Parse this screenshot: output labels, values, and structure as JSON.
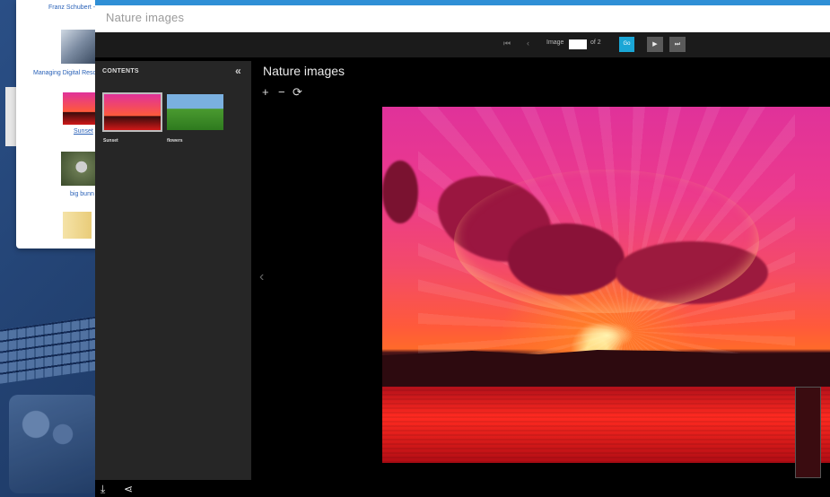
{
  "background": {
    "list": {
      "items": [
        {
          "caption": "Franz Schubert -"
        },
        {
          "caption": "Managing Digital Reso"
        },
        {
          "caption": "Sunset"
        },
        {
          "caption": "big bunn"
        },
        {
          "caption": ""
        }
      ]
    }
  },
  "dialog": {
    "title": "Nature images",
    "toolbar": {
      "first_icon": "first-page-icon",
      "prev_icon": "prev-page-icon",
      "image_label": "Image",
      "page_value": "",
      "of_label": "of 2",
      "go_label": "Go",
      "play_icon": "play-icon",
      "last_icon": "last-page-icon"
    },
    "contents": {
      "title": "CONTENTS",
      "collapse_icon": "double-chevron-left-icon",
      "items": [
        {
          "label": "Sunset",
          "selected": true
        },
        {
          "label": "flowers",
          "selected": false
        }
      ]
    },
    "viewer": {
      "title": "Nature images",
      "zoom_in_icon": "plus-icon",
      "zoom_out_icon": "minus-icon",
      "rotate_icon": "rotate-icon",
      "prev_icon": "chevron-left-icon"
    },
    "footer": {
      "download_icon": "download-icon",
      "share_icon": "share-icon"
    }
  },
  "colors": {
    "accent": "#1aa6d6",
    "topbar": "#2f8fd6"
  }
}
